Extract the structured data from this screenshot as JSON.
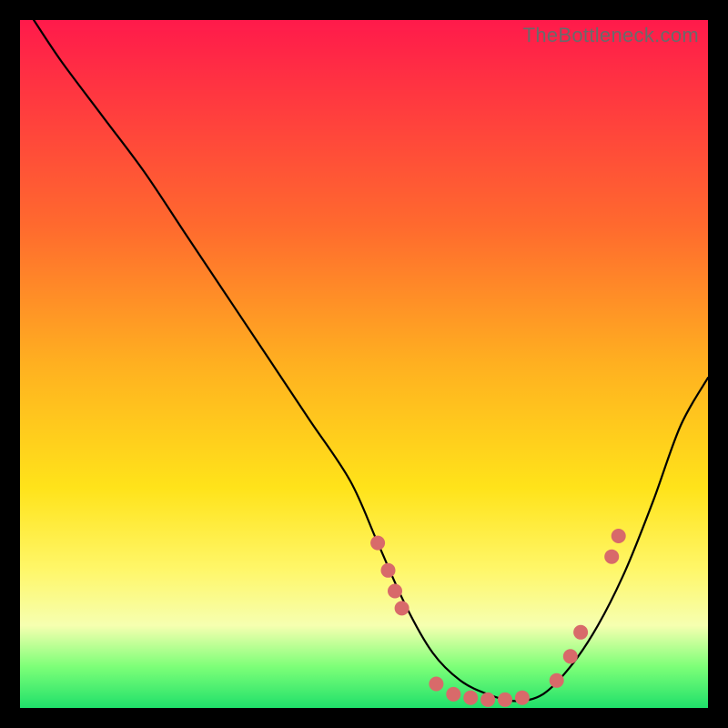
{
  "watermark": "TheBottleneck.com",
  "chart_data": {
    "type": "line",
    "title": "",
    "xlabel": "",
    "ylabel": "",
    "xlim": [
      0,
      100
    ],
    "ylim": [
      0,
      100
    ],
    "legend": false,
    "grid": false,
    "background": "vertical-gradient red→yellow→green",
    "series": [
      {
        "name": "bottleneck-curve",
        "x": [
          2,
          6,
          12,
          18,
          24,
          30,
          36,
          42,
          48,
          52,
          56,
          60,
          64,
          68,
          72,
          76,
          80,
          84,
          88,
          92,
          96,
          100
        ],
        "y": [
          100,
          94,
          86,
          78,
          69,
          60,
          51,
          42,
          33,
          24,
          15,
          8,
          4,
          2,
          1,
          2,
          6,
          12,
          20,
          30,
          41,
          48
        ]
      }
    ],
    "markers": [
      {
        "name": "dot",
        "x": 52.0,
        "y": 24.0
      },
      {
        "name": "dot",
        "x": 53.5,
        "y": 20.0
      },
      {
        "name": "dot",
        "x": 54.5,
        "y": 17.0
      },
      {
        "name": "dot",
        "x": 55.5,
        "y": 14.5
      },
      {
        "name": "dot",
        "x": 60.5,
        "y": 3.5
      },
      {
        "name": "dot",
        "x": 63.0,
        "y": 2.0
      },
      {
        "name": "dot",
        "x": 65.5,
        "y": 1.5
      },
      {
        "name": "dot",
        "x": 68.0,
        "y": 1.2
      },
      {
        "name": "dot",
        "x": 70.5,
        "y": 1.2
      },
      {
        "name": "dot",
        "x": 73.0,
        "y": 1.5
      },
      {
        "name": "dot",
        "x": 78.0,
        "y": 4.0
      },
      {
        "name": "dot",
        "x": 80.0,
        "y": 7.5
      },
      {
        "name": "dot",
        "x": 81.5,
        "y": 11.0
      },
      {
        "name": "dot",
        "x": 86.0,
        "y": 22.0
      },
      {
        "name": "dot",
        "x": 87.0,
        "y": 25.0
      }
    ]
  }
}
